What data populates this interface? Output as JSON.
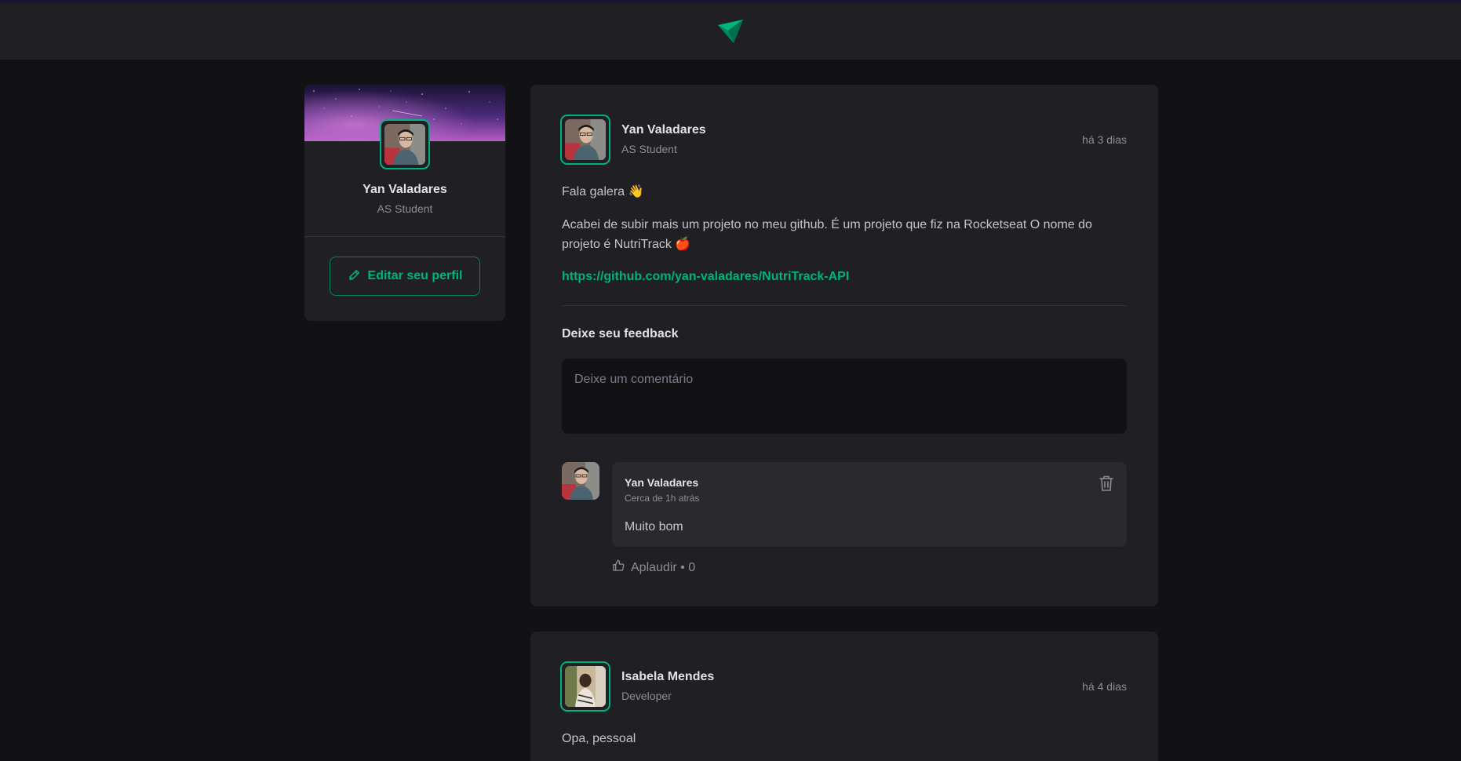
{
  "header": {
    "logo_icon": "paper-plane-logo-icon"
  },
  "sidebar": {
    "cover_icon": "starry-sky-cover-image",
    "avatar_icon": "user-avatar-image",
    "name": "Yan Valadares",
    "role": "AS Student",
    "edit_label": "Editar seu perfil",
    "edit_icon": "pencil-icon"
  },
  "posts": [
    {
      "author": {
        "name": "Yan Valadares",
        "role": "AS Student"
      },
      "time": "há 3 dias",
      "paragraphs": [
        "Fala galera 👋",
        "Acabei de subir mais um projeto no meu github. É um projeto que fiz na Rocketseat O nome do projeto é NutriTrack 🍎"
      ],
      "link": "https://github.com/yan-valadares/NutriTrack-API",
      "feedback_title": "Deixe seu feedback",
      "comment_placeholder": "Deixe um comentário",
      "comments": [
        {
          "author": "Yan Valadares",
          "time": "Cerca de 1h atrás",
          "text": "Muito bom",
          "applaud_label": "Aplaudir • 0"
        }
      ]
    },
    {
      "author": {
        "name": "Isabela Mendes",
        "role": "Developer"
      },
      "time": "há 4 dias",
      "paragraphs": [
        "Opa, pessoal"
      ]
    }
  ],
  "colors": {
    "accent": "#00b37e",
    "accent_dark": "#00875f",
    "background": "#121214",
    "card": "#202024",
    "comment_bg": "#29292e"
  }
}
